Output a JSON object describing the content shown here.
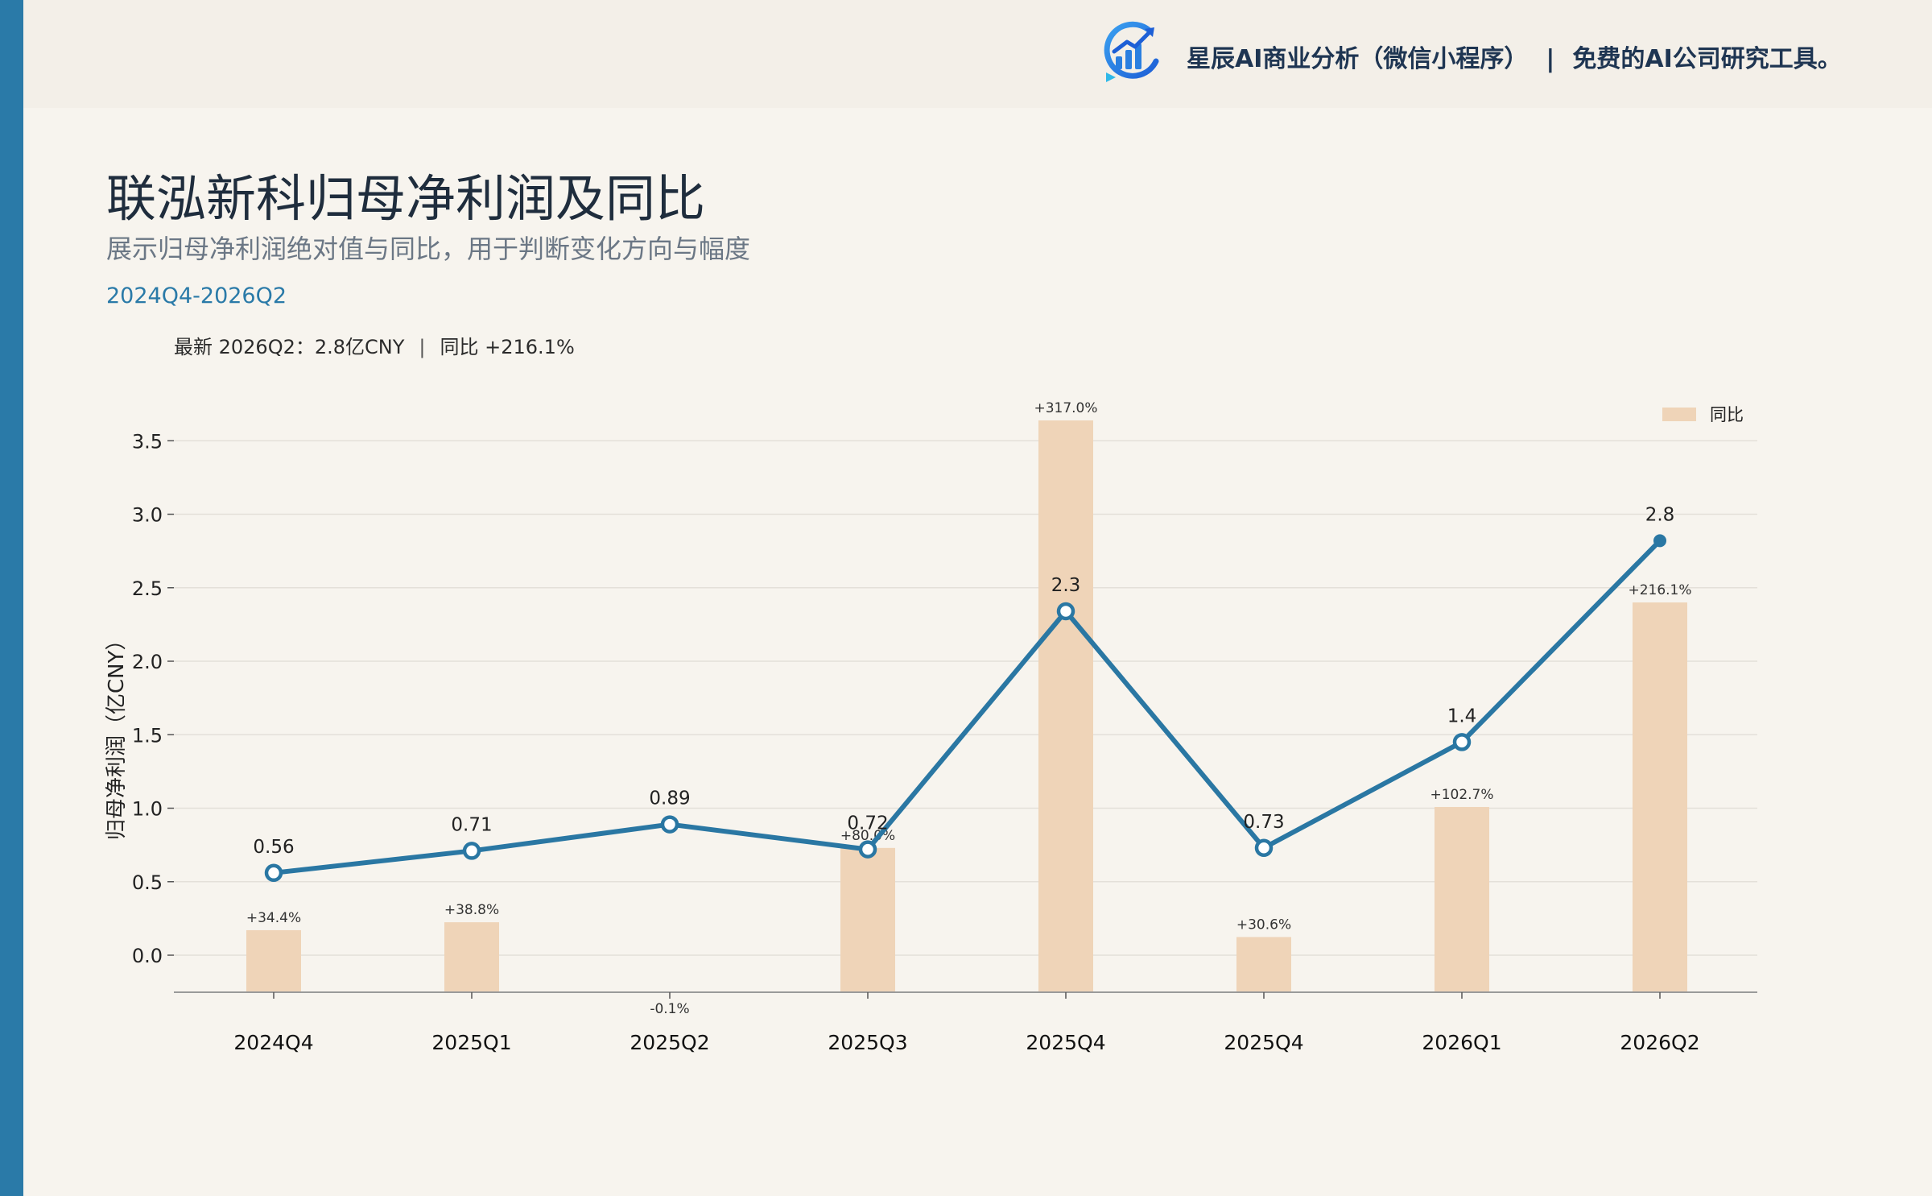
{
  "brand": {
    "name": "星辰AI商业分析（微信小程序）",
    "separator": "|",
    "tagline": "免费的AI公司研究工具。",
    "logo_icon": "bar-chart-growth-logo-icon"
  },
  "header": {
    "title": "联泓新科归母净利润及同比",
    "subtitle": "展示归母净利润绝对值与同比，用于判断变化方向与幅度",
    "range": "2024Q4-2026Q2"
  },
  "latest": {
    "value_text": "最新 2026Q2：2.8亿CNY",
    "separator": "|",
    "yoy_text": "同比 +216.1%"
  },
  "colors": {
    "line": "#2a77a3",
    "bar": "#efd4b8",
    "accent_bar": "#2a7aa8",
    "background": "#f7f4ee"
  },
  "chart_data": {
    "type": "bar+line",
    "ylabel": "归母净利润（亿CNY）",
    "ylim": [
      -0.25,
      3.7
    ],
    "yticks": [
      0.0,
      0.5,
      1.0,
      1.5,
      2.0,
      2.5,
      3.0,
      3.5
    ],
    "ytick_labels": [
      "0.0",
      "0.5",
      "1.0",
      "1.5",
      "2.0",
      "2.5",
      "3.0",
      "3.5"
    ],
    "grid": true,
    "legend_position": "top-right",
    "categories": [
      "2024Q4",
      "2025Q1",
      "2025Q2",
      "2025Q3",
      "2025Q4",
      "2025Q4",
      "2026Q1",
      "2026Q2"
    ],
    "line_series": {
      "name": "",
      "values": [
        0.56,
        0.71,
        0.89,
        0.72,
        2.34,
        0.73,
        1.45,
        2.82
      ],
      "labels": [
        "0.56",
        "0.71",
        "0.89",
        "0.72",
        "2.3",
        "0.73",
        "1.4",
        "2.8"
      ]
    },
    "bar_series": {
      "name": "同比",
      "values": [
        34.4,
        38.8,
        -0.1,
        80.0,
        317.0,
        30.6,
        102.7,
        216.1
      ],
      "labels": [
        "+34.4%",
        "+38.8%",
        "-0.1%",
        "+80.0%",
        "+317.0%",
        "+30.6%",
        "+102.7%",
        "+216.1%"
      ]
    }
  }
}
